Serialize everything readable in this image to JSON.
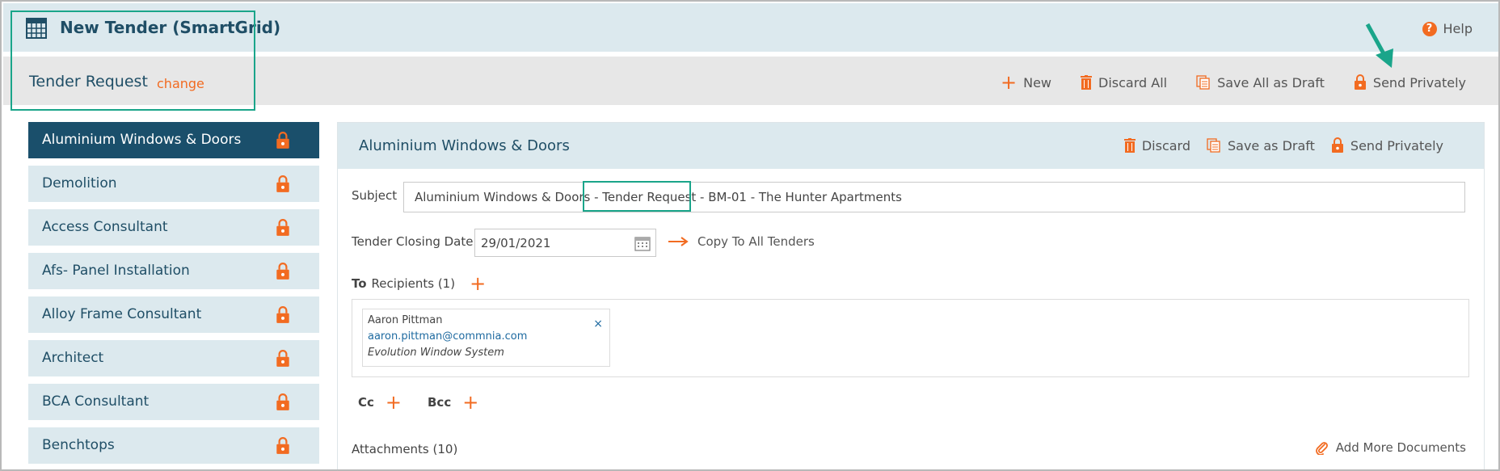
{
  "header": {
    "title": "New Tender (SmartGrid)",
    "help_label": "Help"
  },
  "subheader": {
    "title": "Tender Request",
    "change_label": "change",
    "toolbar": {
      "new_label": "New",
      "discard_all_label": "Discard All",
      "save_all_label": "Save All as Draft",
      "send_label": "Send Privately"
    }
  },
  "sidebar": {
    "items": [
      {
        "label": "Aluminium Windows & Doors",
        "active": true
      },
      {
        "label": "Demolition"
      },
      {
        "label": "Access Consultant"
      },
      {
        "label": "Afs- Panel Installation"
      },
      {
        "label": "Alloy Frame Consultant"
      },
      {
        "label": "Architect"
      },
      {
        "label": "BCA Consultant"
      },
      {
        "label": "Benchtops"
      }
    ]
  },
  "main": {
    "title": "Aluminium Windows & Doors",
    "discard_label": "Discard",
    "save_label": "Save as Draft",
    "send_label": "Send Privately",
    "subject_label": "Subject",
    "subject_value": "Aluminium Windows & Doors - Tender Request - BM-01 - The Hunter Apartments",
    "closing_label": "Tender Closing Date",
    "closing_value": "29/01/2021",
    "copy_label": "Copy To All Tenders",
    "to_label": "To",
    "recipients_label": "Recipients (1)",
    "recipient": {
      "name": "Aaron Pittman",
      "email": "aaron.pittman@commnia.com",
      "company": "Evolution Window System",
      "remove": "×"
    },
    "cc_label": "Cc",
    "bcc_label": "Bcc",
    "attachments_label": "Attachments (10)",
    "add_docs_label": "Add More Documents"
  },
  "colors": {
    "accent": "#f26b21",
    "navy": "#1a4f6b",
    "highlight": "#1aa58a",
    "pale_blue": "#dce9ee"
  }
}
